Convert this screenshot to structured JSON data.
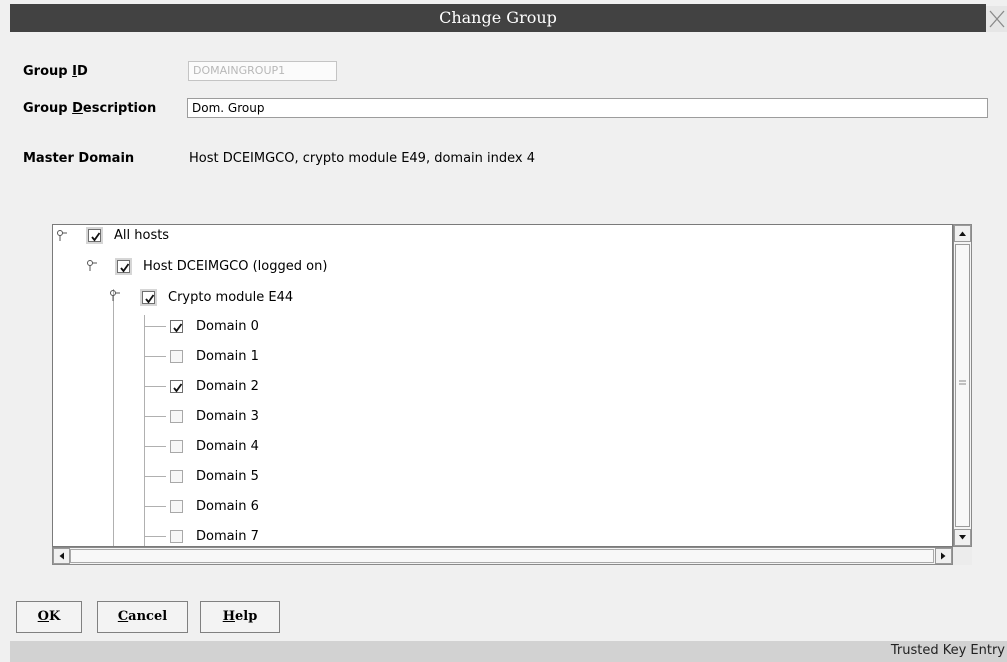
{
  "dialog": {
    "title": "Change Group"
  },
  "form": {
    "group_id_label_a": "Group ",
    "group_id_label_mn": "I",
    "group_id_label_b": "D",
    "group_id_value": "DOMAINGROUP1",
    "group_desc_label_a": "Group ",
    "group_desc_label_mn": "D",
    "group_desc_label_b": "escription",
    "group_desc_value": "Dom. Group",
    "master_domain_label": "Master Domain",
    "master_domain_value": "Host DCEIMGCO, crypto module E49, domain index 4"
  },
  "tree": {
    "nodes": [
      {
        "label": "All hosts",
        "checked": true
      },
      {
        "label": "Host DCEIMGCO (logged on)",
        "checked": true
      },
      {
        "label": "Crypto module E44",
        "checked": true
      },
      {
        "label": "Domain 0",
        "checked": true
      },
      {
        "label": "Domain 1",
        "checked": false
      },
      {
        "label": "Domain 2",
        "checked": true
      },
      {
        "label": "Domain 3",
        "checked": false
      },
      {
        "label": "Domain 4",
        "checked": false
      },
      {
        "label": "Domain 5",
        "checked": false
      },
      {
        "label": "Domain 6",
        "checked": false
      },
      {
        "label": "Domain 7",
        "checked": false
      }
    ]
  },
  "buttons": {
    "ok_mn": "O",
    "ok_rest": "K",
    "cancel_mn": "C",
    "cancel_rest": "ancel",
    "help_mn": "H",
    "help_rest": "elp"
  },
  "status": {
    "text": "Trusted Key Entry"
  }
}
